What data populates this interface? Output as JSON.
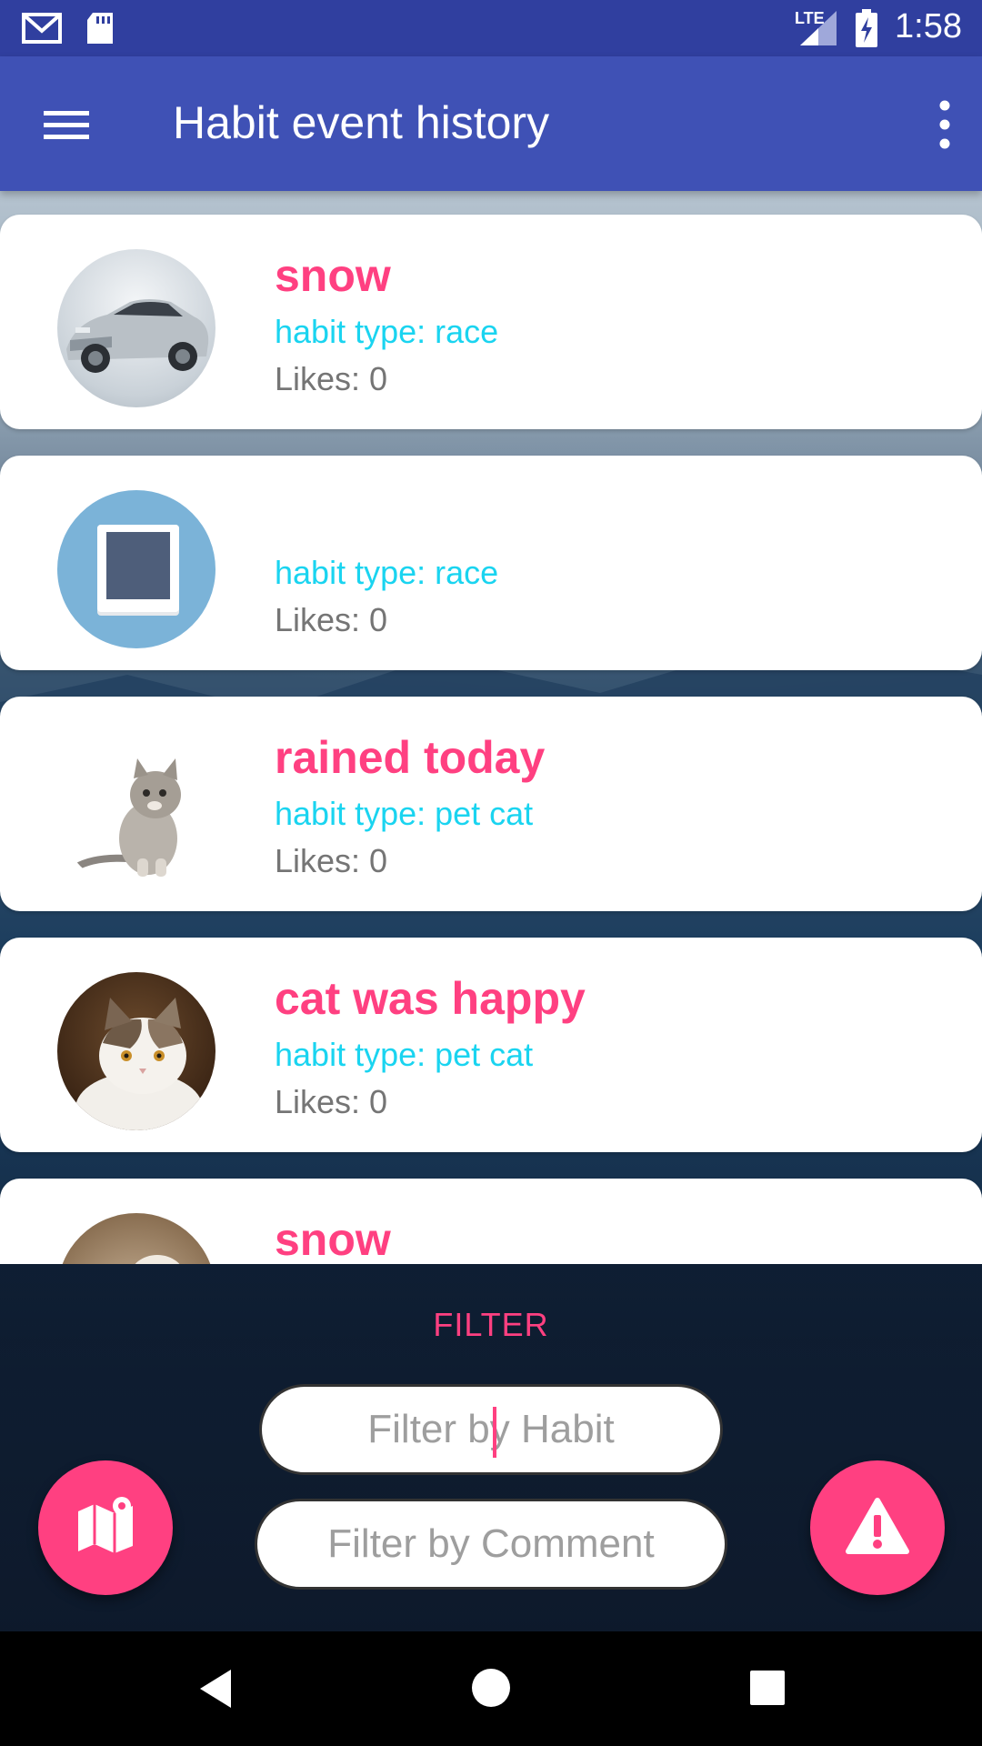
{
  "status_bar": {
    "time": "1:58",
    "network": "LTE"
  },
  "app_bar": {
    "title": "Habit event history"
  },
  "events": [
    {
      "title": "snow",
      "habit_type": "habit type: race",
      "likes": "Likes: 0",
      "thumbnail": "silver-sports-car"
    },
    {
      "title": "",
      "habit_type": "habit type: race",
      "likes": "Likes: 0",
      "thumbnail": "image-placeholder"
    },
    {
      "title": "rained today",
      "habit_type": "habit type: pet cat",
      "likes": "Likes: 0",
      "thumbnail": "kitten"
    },
    {
      "title": "cat was happy",
      "habit_type": "habit type: pet cat",
      "likes": "Likes: 0",
      "thumbnail": "cat-photo"
    },
    {
      "title": "snow",
      "habit_type": "",
      "likes": "",
      "thumbnail": "cat-photo"
    }
  ],
  "filter": {
    "label": "FILTER",
    "habit_placeholder": "Filter by Habit",
    "comment_placeholder": "Filter by Comment"
  },
  "colors": {
    "primary": "#3f51b5",
    "primary_dark": "#303f9f",
    "accent": "#ff4081",
    "habit_type": "#1ad4f0"
  },
  "icons": {
    "map_fab": "map-icon",
    "alert_fab": "warning-icon",
    "nav": [
      "back-icon",
      "home-icon",
      "recents-icon"
    ]
  }
}
